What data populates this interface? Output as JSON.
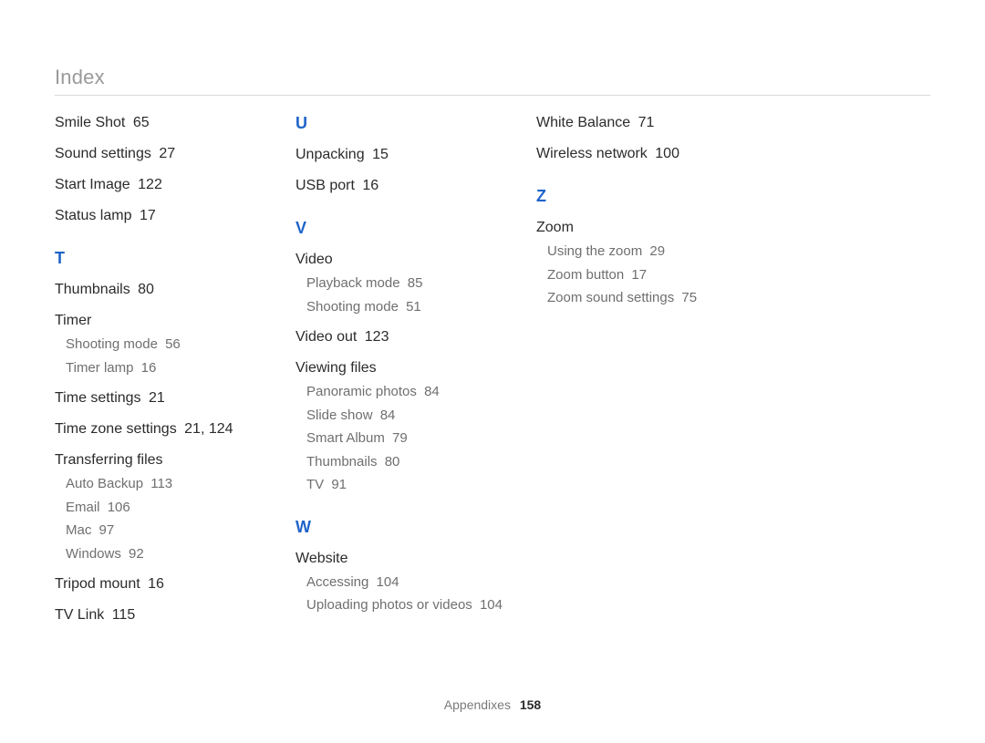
{
  "header": {
    "title": "Index"
  },
  "footer": {
    "section": "Appendixes",
    "page": "158"
  },
  "col1": {
    "pre_entries": [
      {
        "label": "Smile Shot",
        "page": "65"
      },
      {
        "label": "Sound settings",
        "page": "27"
      },
      {
        "label": "Start Image",
        "page": "122"
      },
      {
        "label": "Status lamp",
        "page": "17"
      }
    ],
    "letter_T": "T",
    "t_thumbnails": {
      "label": "Thumbnails",
      "page": "80"
    },
    "t_timer_label": "Timer",
    "t_timer_subs": [
      {
        "label": "Shooting mode",
        "page": "56"
      },
      {
        "label": "Timer lamp",
        "page": "16"
      }
    ],
    "t_time_settings": {
      "label": "Time settings",
      "page": "21"
    },
    "t_time_zone": {
      "label": "Time zone settings",
      "page": "21, 124"
    },
    "t_transferring_label": "Transferring files",
    "t_transferring_subs": [
      {
        "label": "Auto Backup",
        "page": "113"
      },
      {
        "label": "Email",
        "page": "106"
      },
      {
        "label": "Mac",
        "page": "97"
      },
      {
        "label": "Windows",
        "page": "92"
      }
    ],
    "t_tripod": {
      "label": "Tripod mount",
      "page": "16"
    },
    "t_tvlink": {
      "label": "TV Link",
      "page": "115"
    }
  },
  "col2": {
    "letter_U": "U",
    "u_entries": [
      {
        "label": "Unpacking",
        "page": "15"
      },
      {
        "label": "USB port",
        "page": "16"
      }
    ],
    "letter_V": "V",
    "v_video_label": "Video",
    "v_video_subs": [
      {
        "label": "Playback mode",
        "page": "85"
      },
      {
        "label": "Shooting mode",
        "page": "51"
      }
    ],
    "v_video_out": {
      "label": "Video out",
      "page": "123"
    },
    "v_viewing_label": "Viewing files",
    "v_viewing_subs": [
      {
        "label": "Panoramic photos",
        "page": "84"
      },
      {
        "label": "Slide show",
        "page": "84"
      },
      {
        "label": "Smart Album",
        "page": "79"
      },
      {
        "label": "Thumbnails",
        "page": "80"
      },
      {
        "label": "TV",
        "page": "91"
      }
    ],
    "letter_W": "W",
    "w_website_label": "Website",
    "w_website_subs": [
      {
        "label": "Accessing",
        "page": "104"
      },
      {
        "label": "Uploading photos or videos",
        "page": "104"
      }
    ]
  },
  "col3": {
    "pre_entries": [
      {
        "label": "White Balance",
        "page": "71"
      },
      {
        "label": "Wireless network",
        "page": "100"
      }
    ],
    "letter_Z": "Z",
    "z_zoom_label": "Zoom",
    "z_zoom_subs": [
      {
        "label": "Using the zoom",
        "page": "29"
      },
      {
        "label": "Zoom button",
        "page": "17"
      },
      {
        "label": "Zoom sound settings",
        "page": "75"
      }
    ]
  }
}
